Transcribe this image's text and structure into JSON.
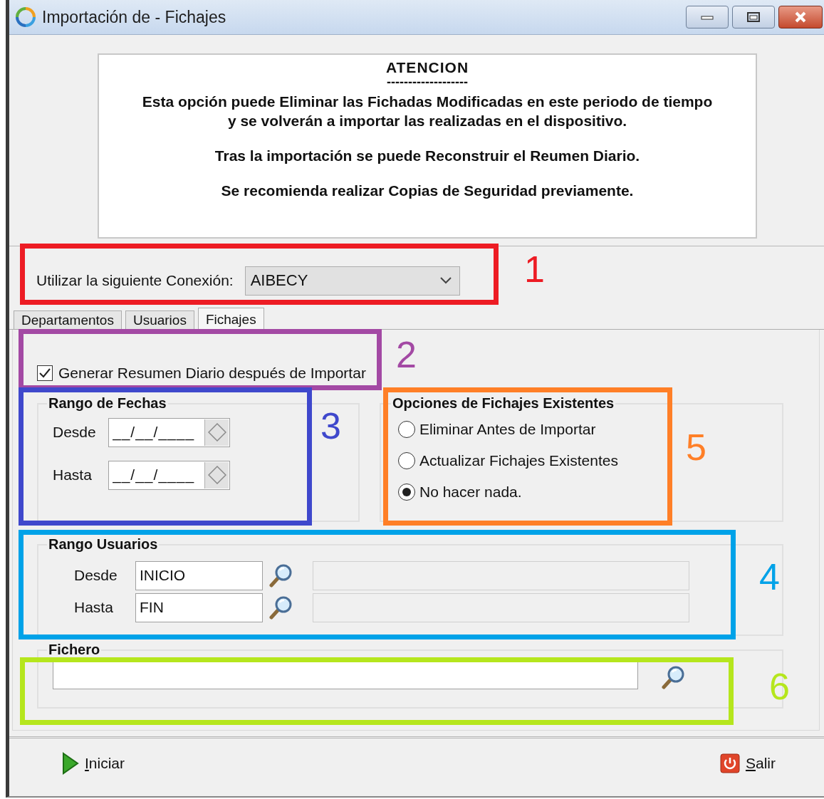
{
  "window": {
    "title": "Importación de - Fichajes"
  },
  "notice": {
    "heading": "ATENCION",
    "separator": "-------------------",
    "paragraphs": [
      [
        "Esta opción puede Eliminar las Fichadas Modificadas en este periodo de tiempo",
        "y se volverán a importar las realizadas en el dispositivo."
      ],
      [
        "Tras la importación se puede Reconstruir el Reumen Diario."
      ],
      [
        "Se recomienda realizar Copias de Seguridad previamente."
      ]
    ]
  },
  "connection": {
    "label": "Utilizar la siguiente Conexión:",
    "value": "AIBECY"
  },
  "tabs": [
    {
      "label": "Departamentos",
      "selected": false
    },
    {
      "label": "Usuarios",
      "selected": false
    },
    {
      "label": "Fichajes",
      "selected": true
    }
  ],
  "generate_summary": {
    "label": "Generar Resumen Diario después de Importar",
    "checked": true
  },
  "date_range": {
    "title": "Rango de Fechas",
    "fields": [
      {
        "label": "Desde",
        "value": "__/__/____"
      },
      {
        "label": "Hasta",
        "value": "__/__/____"
      }
    ]
  },
  "existing_options": {
    "title": "Opciones de Fichajes Existentes",
    "options": [
      {
        "label": "Eliminar Antes de Importar",
        "selected": false
      },
      {
        "label": "Actualizar Fichajes Existentes",
        "selected": false
      },
      {
        "label": "No hacer nada.",
        "selected": true
      }
    ]
  },
  "user_range": {
    "title": "Rango Usuarios",
    "rows": [
      {
        "label": "Desde",
        "value": "INICIO"
      },
      {
        "label": "Hasta",
        "value": "FIN"
      }
    ]
  },
  "file": {
    "title": "Fichero"
  },
  "buttons": [
    {
      "label": "Iniciar",
      "kind": "start"
    },
    {
      "label": "Salir",
      "kind": "exit"
    }
  ],
  "annotations": [
    {
      "number": "1",
      "color": "#ed1c24"
    },
    {
      "number": "2",
      "color": "#a349a4"
    },
    {
      "number": "3",
      "color": "#3f48cc"
    },
    {
      "number": "4",
      "color": "#00a2e8"
    },
    {
      "number": "5",
      "color": "#ff7f27"
    },
    {
      "number": "6",
      "color": "#b5e61d"
    }
  ]
}
